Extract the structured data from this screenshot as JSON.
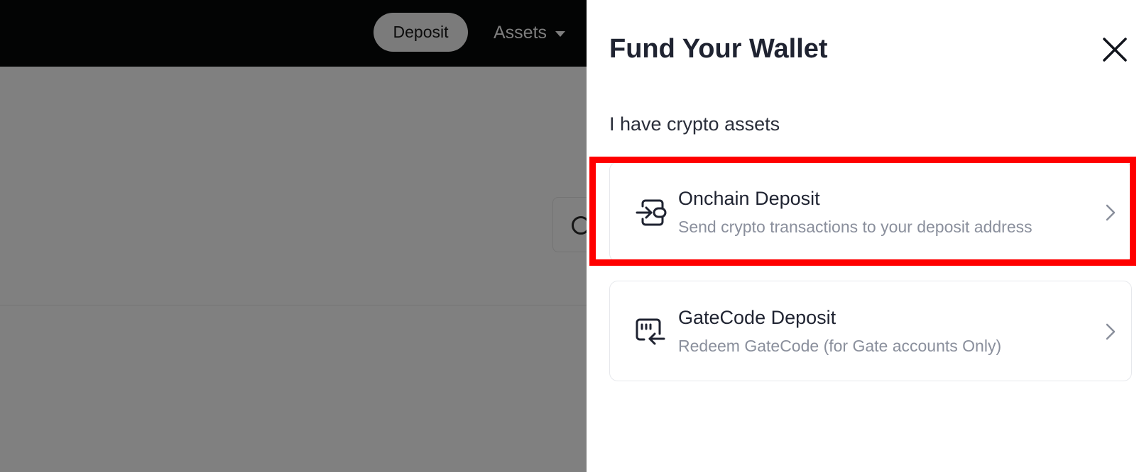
{
  "background": {
    "nav": {
      "deposit_label": "Deposit",
      "assets_label": "Assets"
    }
  },
  "drawer": {
    "title": "Fund Your Wallet",
    "section_label": "I have crypto assets",
    "options": [
      {
        "title": "Onchain Deposit",
        "description": "Send crypto transactions to your deposit address",
        "icon": "onchain-transfer-icon"
      },
      {
        "title": "GateCode Deposit",
        "description": "Redeem GateCode (for Gate accounts Only)",
        "icon": "gatecode-icon"
      }
    ]
  },
  "colors": {
    "overlay": "#808080",
    "topbar": "#030404",
    "title_text": "#1f2331",
    "muted_text": "#8a8f9c",
    "highlight": "#ff0000"
  }
}
